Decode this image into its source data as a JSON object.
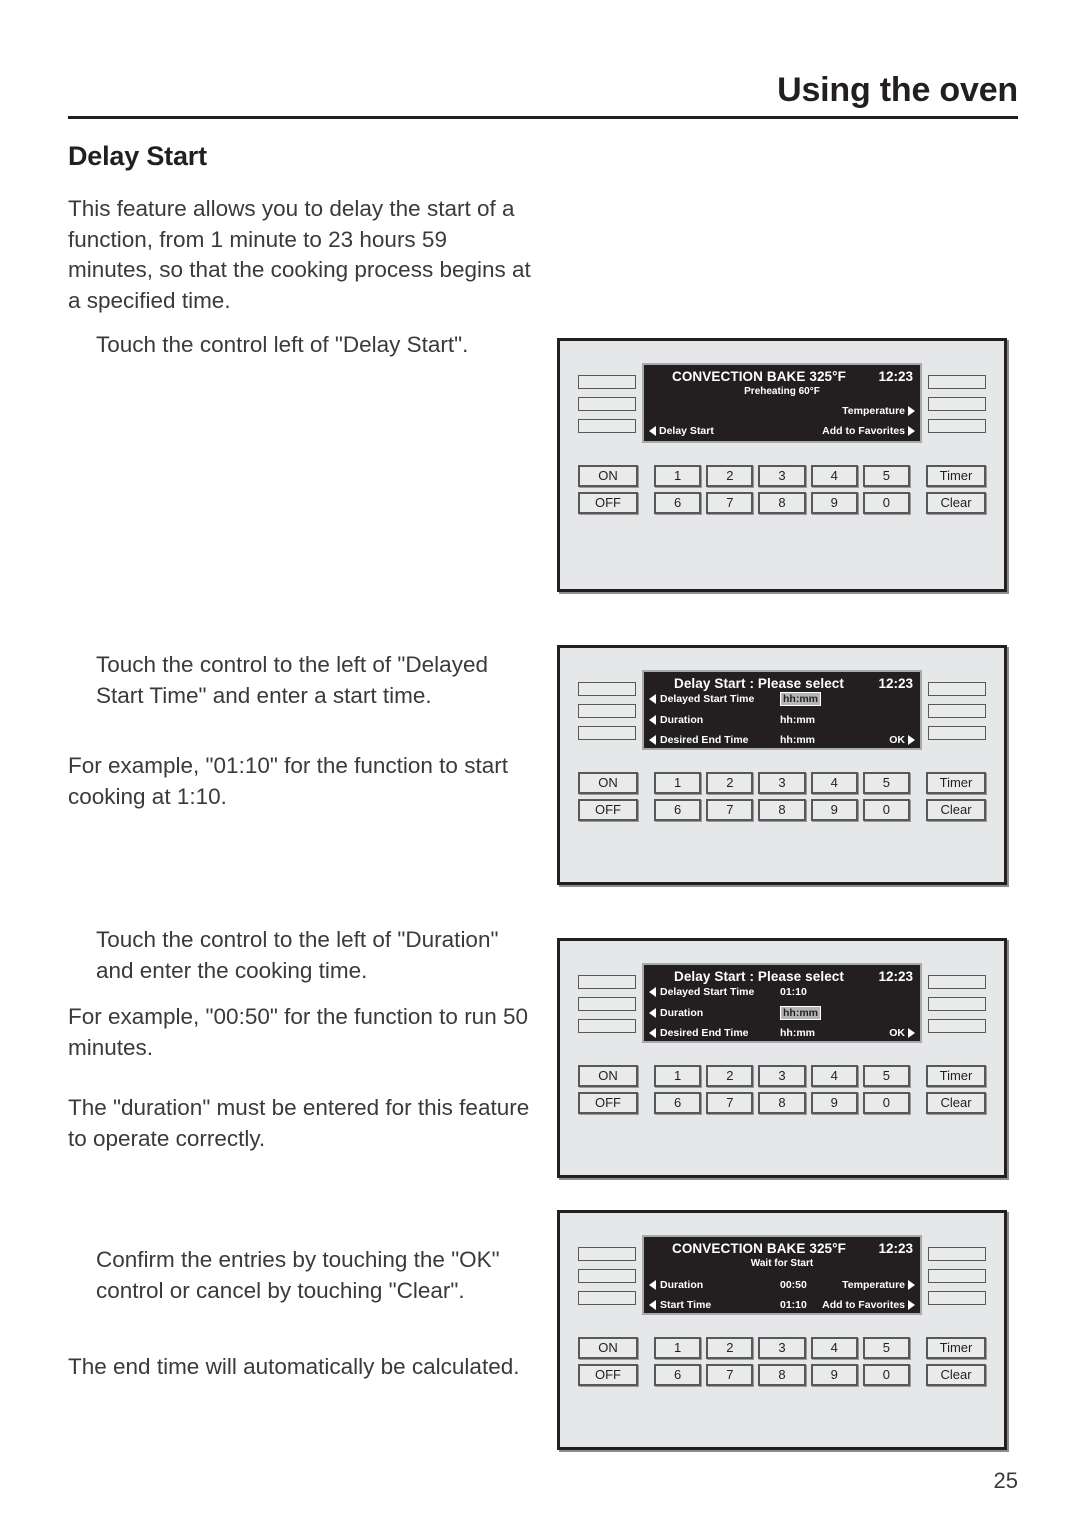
{
  "header": {
    "title": "Using the oven"
  },
  "section": {
    "heading": "Delay Start"
  },
  "body": {
    "p1": "This feature allows you to delay the start of a function, from 1 minute to 23 hours 59 minutes, so that the cooking process begins at a specified time.",
    "p1b": "Touch the control left of \"Delay Start\".",
    "p2": "Touch the control to the left of \"Delayed Start Time\" and enter a start time.",
    "p2b": "For example, \"01:10\" for the function to start cooking at 1:10.",
    "p3": "Touch the control to the left of \"Duration\" and enter the cooking time.",
    "p3b": "For example, \"00:50\" for the function to run 50 minutes.",
    "p3c": "The \"duration\" must be entered for this feature to operate correctly.",
    "p4": "Confirm the entries by touching the \"OK\" control or cancel by touching \"Clear\".",
    "p4b": "The end time will automatically be calculated."
  },
  "page_number": "25",
  "keypad": {
    "on": "ON",
    "off": "OFF",
    "timer": "Timer",
    "clear": "Clear",
    "row1": [
      "1",
      "2",
      "3",
      "4",
      "5"
    ],
    "row2": [
      "6",
      "7",
      "8",
      "9",
      "0"
    ]
  },
  "panels": [
    {
      "id": "panel-preheating",
      "lcd": {
        "title": "CONVECTION BAKE 325°F",
        "clock": "12:23",
        "subtitle": "Preheating 60°F",
        "left_labels": [
          "Delay Start"
        ],
        "right_labels": [
          "Temperature",
          "Add to Favorites"
        ]
      }
    },
    {
      "id": "panel-select-start-time",
      "lcd": {
        "title": "Delay Start : Please select",
        "clock": "12:23",
        "rows": [
          {
            "label": "Delayed Start Time",
            "value": "hh:mm",
            "highlighted": true
          },
          {
            "label": "Duration",
            "value": "hh:mm",
            "highlighted": false
          },
          {
            "label": "Desired End Time",
            "value": "hh:mm",
            "highlighted": false,
            "ok": "OK"
          }
        ]
      }
    },
    {
      "id": "panel-select-duration",
      "lcd": {
        "title": "Delay Start : Please select",
        "clock": "12:23",
        "rows": [
          {
            "label": "Delayed Start Time",
            "value": "01:10",
            "highlighted": false
          },
          {
            "label": "Duration",
            "value": "hh:mm",
            "highlighted": true
          },
          {
            "label": "Desired End Time",
            "value": "hh:mm",
            "highlighted": false,
            "ok": "OK"
          }
        ]
      }
    },
    {
      "id": "panel-wait-for-start",
      "lcd": {
        "title": "CONVECTION BAKE 325°F",
        "clock": "12:23",
        "subtitle": "Wait for Start",
        "rows": [
          {
            "label": "Duration",
            "value": "00:50",
            "right": "Temperature"
          },
          {
            "label": "Start Time",
            "value": "01:10",
            "right": "Add to Favorites"
          }
        ]
      }
    }
  ],
  "colors": {
    "ink": "#231f20",
    "panel_face": "#e6e7e8",
    "lcd_bg": "#231f20",
    "lcd_fg": "#ffffff",
    "highlight": "#b5b5b5"
  }
}
